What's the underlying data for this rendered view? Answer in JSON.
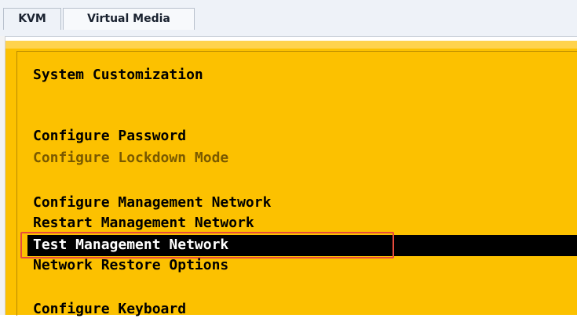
{
  "tabs": [
    {
      "label": "KVM"
    },
    {
      "label": "Virtual Media"
    }
  ],
  "console": {
    "heading": "System Customization",
    "menu": [
      {
        "label": "Configure Password"
      },
      {
        "label": "Configure Lockdown Mode"
      },
      {
        "label": "Configure Management Network"
      },
      {
        "label": "Restart Management Network"
      },
      {
        "label": "Test Management Network"
      },
      {
        "label": "Network Restore Options"
      },
      {
        "label": "Configure Keyboard"
      }
    ]
  },
  "colors": {
    "console_bg": "#fcc100",
    "selected_bg": "#000000",
    "selected_fg": "#ffffff",
    "highlight_border": "#e84c3d"
  }
}
